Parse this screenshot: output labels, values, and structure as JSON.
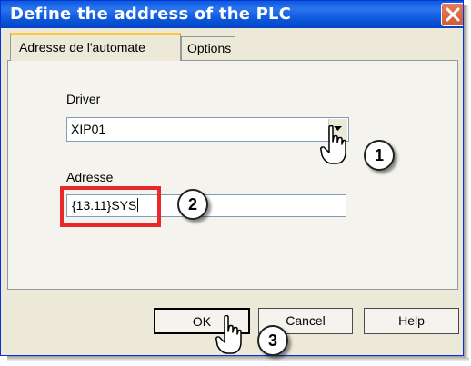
{
  "window": {
    "title": "Define the address of the PLC"
  },
  "tabs": [
    {
      "label": "Adresse de l'automate",
      "active": true
    },
    {
      "label": "Options",
      "active": false
    }
  ],
  "driver": {
    "label": "Driver",
    "value": "XIP01"
  },
  "address": {
    "label": "Adresse",
    "value": "{13.11}SYS"
  },
  "buttons": {
    "ok": "OK",
    "cancel": "Cancel",
    "help": "Help"
  },
  "callouts": [
    "1",
    "2",
    "3"
  ],
  "icons": {
    "close": "close-icon",
    "dropdown": "chevron-down-icon",
    "pointer": "hand-pointer-icon"
  },
  "colors": {
    "titlebar": "#0a55d9",
    "close": "#d35b34",
    "highlight": "#e8282a",
    "dialog": "#ece9d8"
  }
}
